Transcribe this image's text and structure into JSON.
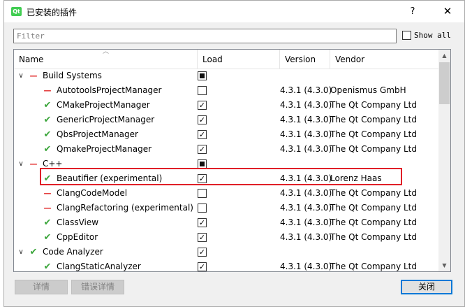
{
  "window": {
    "title": "已安装的插件",
    "icon_text": "Qt",
    "help_glyph": "?",
    "close_glyph": "✕"
  },
  "filter": {
    "placeholder": "Filter",
    "value": ""
  },
  "show_all": {
    "label": "Show all",
    "checked": false
  },
  "table": {
    "columns": {
      "name": "Name",
      "load": "Load",
      "version": "Version",
      "vendor": "Vendor"
    },
    "rows": [
      {
        "level": 0,
        "expand": "∨",
        "status": "no",
        "name": "Build Systems",
        "load": "partial",
        "version": "",
        "vendor": ""
      },
      {
        "level": 1,
        "status": "no",
        "name": "AutotoolsProjectManager",
        "load": "unchecked",
        "version": "4.3.1 (4.3.0)",
        "vendor": "Openismus GmbH"
      },
      {
        "level": 1,
        "status": "ok",
        "name": "CMakeProjectManager",
        "load": "checked",
        "version": "4.3.1 (4.3.0)",
        "vendor": "The Qt Company Ltd"
      },
      {
        "level": 1,
        "status": "ok",
        "name": "GenericProjectManager",
        "load": "checked",
        "version": "4.3.1 (4.3.0)",
        "vendor": "The Qt Company Ltd"
      },
      {
        "level": 1,
        "status": "ok",
        "name": "QbsProjectManager",
        "load": "checked",
        "version": "4.3.1 (4.3.0)",
        "vendor": "The Qt Company Ltd"
      },
      {
        "level": 1,
        "status": "ok",
        "name": "QmakeProjectManager",
        "load": "checked",
        "version": "4.3.1 (4.3.0)",
        "vendor": "The Qt Company Ltd"
      },
      {
        "level": 0,
        "expand": "∨",
        "status": "no",
        "name": "C++",
        "load": "partial",
        "version": "",
        "vendor": ""
      },
      {
        "level": 1,
        "status": "ok",
        "name": "Beautifier (experimental)",
        "load": "checked",
        "version": "4.3.1 (4.3.0)",
        "vendor": "Lorenz Haas"
      },
      {
        "level": 1,
        "status": "no",
        "name": "ClangCodeModel",
        "load": "unchecked",
        "version": "4.3.1 (4.3.0)",
        "vendor": "The Qt Company Ltd"
      },
      {
        "level": 1,
        "status": "no",
        "name": "ClangRefactoring (experimental)",
        "load": "unchecked",
        "version": "4.3.1 (4.3.0)",
        "vendor": "The Qt Company Ltd"
      },
      {
        "level": 1,
        "status": "ok",
        "name": "ClassView",
        "load": "checked",
        "version": "4.3.1 (4.3.0)",
        "vendor": "The Qt Company Ltd"
      },
      {
        "level": 1,
        "status": "ok",
        "name": "CppEditor",
        "load": "checked",
        "version": "4.3.1 (4.3.0)",
        "vendor": "The Qt Company Ltd"
      },
      {
        "level": 0,
        "expand": "∨",
        "status": "ok",
        "name": "Code Analyzer",
        "load": "checked",
        "version": "",
        "vendor": ""
      },
      {
        "level": 1,
        "status": "ok",
        "name": "ClangStaticAnalyzer",
        "load": "checked",
        "version": "4.3.1 (4.3.0)",
        "vendor": "The Qt Company Ltd"
      }
    ]
  },
  "buttons": {
    "details": "详情",
    "error_details": "错误详情",
    "close": "关闭"
  },
  "colors": {
    "ok": "#3aa53a",
    "disabled": "#e02020",
    "highlight": "#e02028",
    "accent": "#0078d7"
  }
}
